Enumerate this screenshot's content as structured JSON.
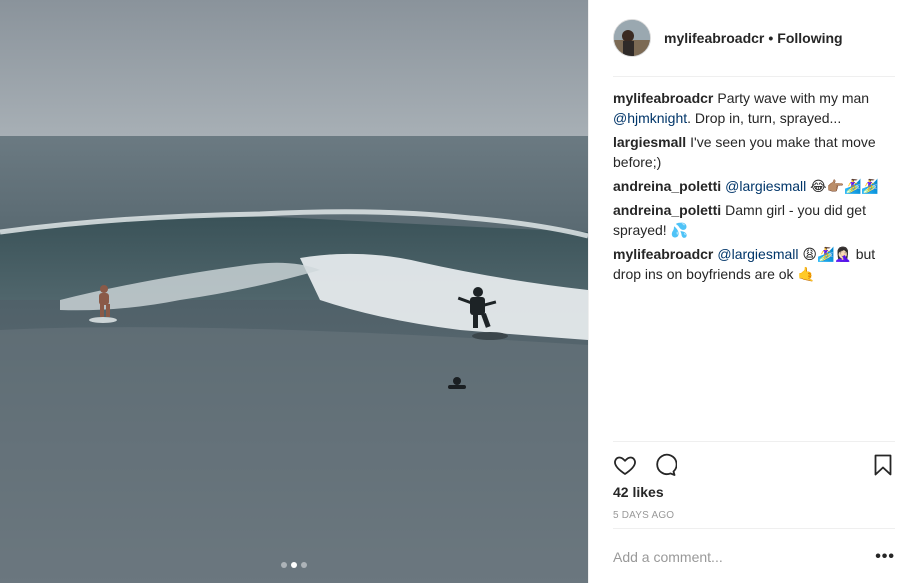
{
  "post": {
    "username": "mylifeabroadcr",
    "separator": "•",
    "follow_status": "Following"
  },
  "comments": [
    {
      "user": "mylifeabroadcr",
      "text_before": "Party wave with my man ",
      "mention": "@hjmknight",
      "text_after": ". Drop in, turn, sprayed..."
    },
    {
      "user": "largiesmall",
      "text_before": "I've seen you make that move before;)",
      "mention": "",
      "text_after": ""
    },
    {
      "user": "andreina_poletti",
      "text_before": "",
      "mention": "@largiesmall",
      "text_after": " 😂👉🏽🏄‍♀️🏄‍♀️"
    },
    {
      "user": "andreina_poletti",
      "text_before": "Damn girl - you did get sprayed! 💦",
      "mention": "",
      "text_after": ""
    },
    {
      "user": "mylifeabroadcr",
      "text_before": "",
      "mention": "@largiesmall",
      "text_after": " 😩🏄‍♀️🤦🏻‍♀️ but drop ins on boyfriends are ok 🤙"
    }
  ],
  "stats": {
    "likes": "42 likes",
    "time": "5 DAYS AGO"
  },
  "composer": {
    "placeholder": "Add a comment...",
    "more": "•••"
  },
  "icons": {
    "like": "heart-icon",
    "comment": "comment-bubble-icon",
    "save": "bookmark-icon"
  },
  "carousel": {
    "count": 3,
    "active_index": 1
  }
}
